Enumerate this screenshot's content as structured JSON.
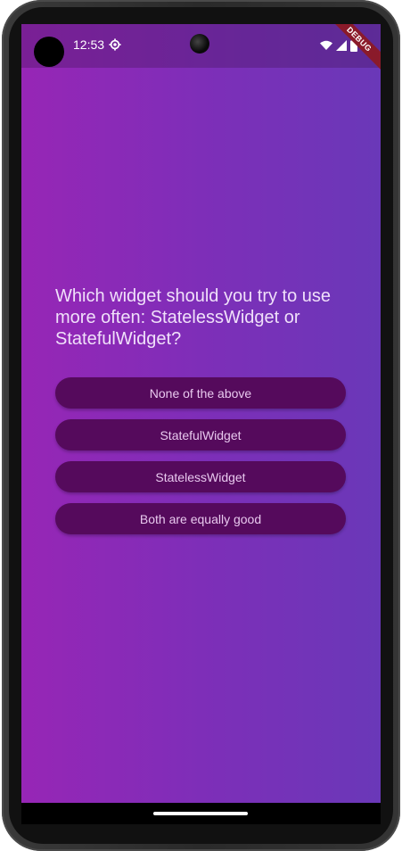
{
  "status_bar": {
    "time": "12:53",
    "icons": [
      "settings-icon",
      "wifi-icon",
      "cellular-signal-icon",
      "battery-icon"
    ]
  },
  "debug_banner": {
    "label": "DEBUG",
    "color": "#8a1a2a"
  },
  "quiz": {
    "question": "Which widget should you try to use more often: StatelessWidget or StatefulWidget?",
    "answers": [
      "None of the above",
      "StatefulWidget",
      "StatelessWidget",
      "Both are equally good"
    ]
  },
  "colors": {
    "gradient_start": "#9726b6",
    "gradient_end": "#6a38b8",
    "button_bg": "#550a5c",
    "button_text": "#e8c8ee",
    "question_text": "#f0e0fa"
  }
}
